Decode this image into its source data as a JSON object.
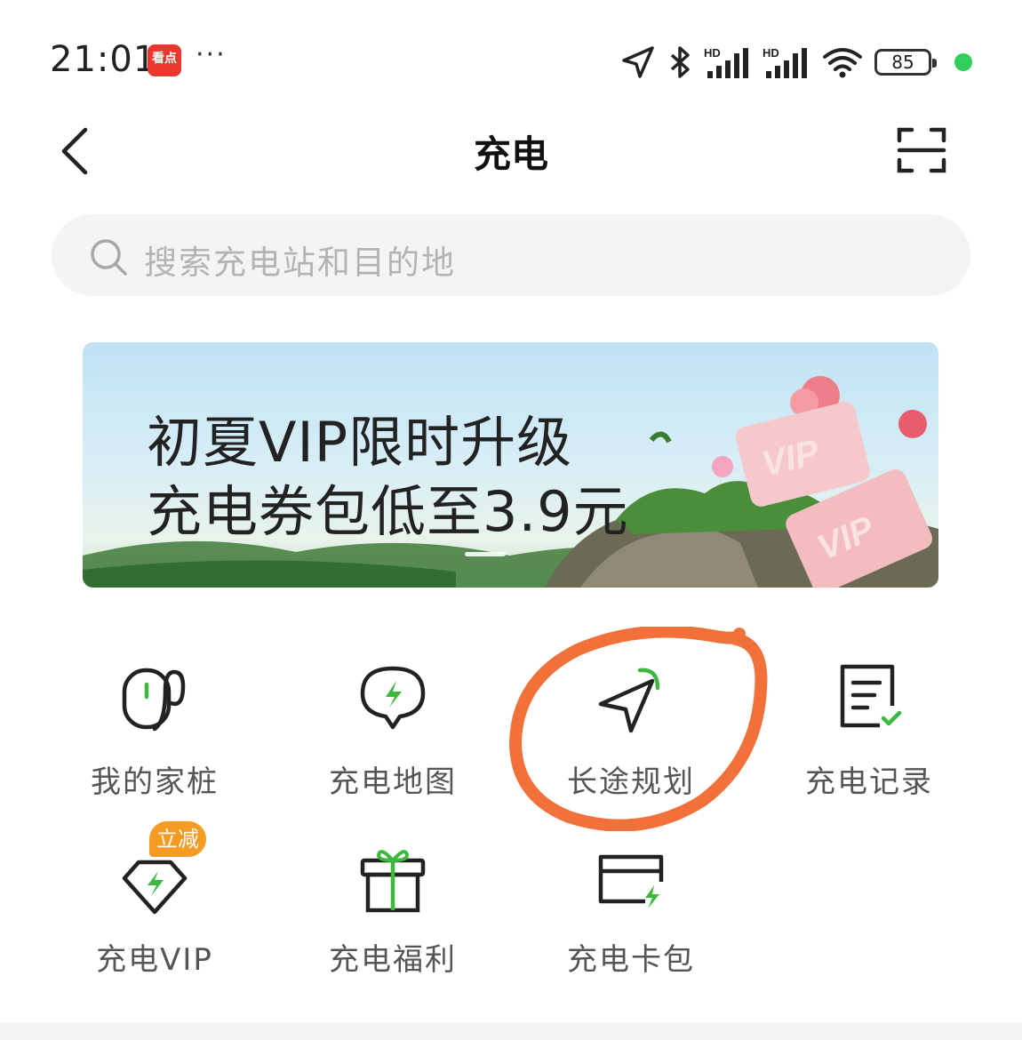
{
  "status_bar": {
    "time": "21:01",
    "app_badge": "看点",
    "more": "···",
    "icons": [
      "location-icon",
      "bluetooth-icon",
      "signal-hd-icon",
      "signal-hd-icon",
      "wifi-icon"
    ],
    "battery": "85",
    "indicator_color": "#2fcf5c"
  },
  "header": {
    "title": "充电",
    "back_icon": "back-chevron-icon",
    "scan_icon": "scan-icon"
  },
  "search": {
    "placeholder": "搜索充电站和目的地"
  },
  "banner": {
    "line1": "初夏VIP限时升级",
    "line2": "充电券包低至3.9元",
    "card_text": "VIP"
  },
  "menu": {
    "row1": [
      {
        "label": "我的家桩",
        "icon": "home-charger-icon"
      },
      {
        "label": "充电地图",
        "icon": "map-pin-bolt-icon"
      },
      {
        "label": "长途规划",
        "icon": "navigation-arrow-icon"
      },
      {
        "label": "充电记录",
        "icon": "record-list-icon"
      }
    ],
    "row2": [
      {
        "label": "充电VIP",
        "icon": "vip-diamond-icon",
        "badge": "立减"
      },
      {
        "label": "充电福利",
        "icon": "gift-icon"
      },
      {
        "label": "充电卡包",
        "icon": "card-wallet-icon"
      }
    ]
  },
  "colors": {
    "accent_green": "#3cb83c",
    "annotation_orange": "#f2703a",
    "badge_orange": "#f59a23"
  }
}
